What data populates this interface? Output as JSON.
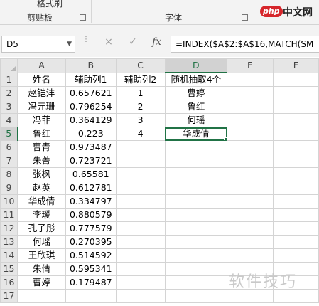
{
  "ribbon": {
    "top_label": "格式刷",
    "groups": [
      {
        "label": "剪贴板"
      },
      {
        "label": "字体"
      }
    ]
  },
  "brand": {
    "logo": "php",
    "text": "中文网"
  },
  "formula_bar": {
    "name_box": "D5",
    "cancel_icon": "×",
    "confirm_icon": "✓",
    "fx_label": "fx",
    "formula": "=INDEX($A$2:$A$16,MATCH(SM"
  },
  "sheet": {
    "columns": [
      "A",
      "B",
      "C",
      "D",
      "E",
      "F"
    ],
    "active_column": "D",
    "active_row": 5,
    "rows": [
      {
        "n": "1",
        "cells": [
          "姓名",
          "辅助列1",
          "辅助列2",
          "随机抽取4个",
          "",
          ""
        ]
      },
      {
        "n": "2",
        "cells": [
          "赵铠沣",
          "0.657621",
          "1",
          "曹婷",
          "",
          ""
        ]
      },
      {
        "n": "3",
        "cells": [
          "冯元珊",
          "0.796254",
          "2",
          "鲁红",
          "",
          ""
        ]
      },
      {
        "n": "4",
        "cells": [
          "冯菲",
          "0.364129",
          "3",
          "何瑶",
          "",
          ""
        ]
      },
      {
        "n": "5",
        "cells": [
          "鲁红",
          "0.223",
          "4",
          "华成倩",
          "",
          ""
        ]
      },
      {
        "n": "6",
        "cells": [
          "曹青",
          "0.973487",
          "",
          "",
          "",
          ""
        ]
      },
      {
        "n": "7",
        "cells": [
          "朱菁",
          "0.723721",
          "",
          "",
          "",
          ""
        ]
      },
      {
        "n": "8",
        "cells": [
          "张枫",
          "0.65581",
          "",
          "",
          "",
          ""
        ]
      },
      {
        "n": "9",
        "cells": [
          "赵英",
          "0.612781",
          "",
          "",
          "",
          ""
        ]
      },
      {
        "n": "10",
        "cells": [
          "华成倩",
          "0.334797",
          "",
          "",
          "",
          ""
        ]
      },
      {
        "n": "11",
        "cells": [
          "李瑗",
          "0.880579",
          "",
          "",
          "",
          ""
        ]
      },
      {
        "n": "12",
        "cells": [
          "孔子彤",
          "0.777579",
          "",
          "",
          "",
          ""
        ]
      },
      {
        "n": "13",
        "cells": [
          "何瑶",
          "0.270395",
          "",
          "",
          "",
          ""
        ]
      },
      {
        "n": "14",
        "cells": [
          "王欣琪",
          "0.514592",
          "",
          "",
          "",
          ""
        ]
      },
      {
        "n": "15",
        "cells": [
          "朱倩",
          "0.595341",
          "",
          "",
          "",
          ""
        ]
      },
      {
        "n": "16",
        "cells": [
          "曹婷",
          "0.179487",
          "",
          "",
          "",
          ""
        ]
      },
      {
        "n": "17",
        "cells": [
          "",
          "",
          "",
          "",
          "",
          ""
        ]
      }
    ]
  },
  "watermark": "软件技巧",
  "icons": {
    "launcher": "dialog-launcher-icon",
    "select_all": "select-all-triangle-icon"
  },
  "colors": {
    "selection": "#217346",
    "header_bg": "#e6e6e6",
    "grid_line": "#d4d4d4"
  }
}
